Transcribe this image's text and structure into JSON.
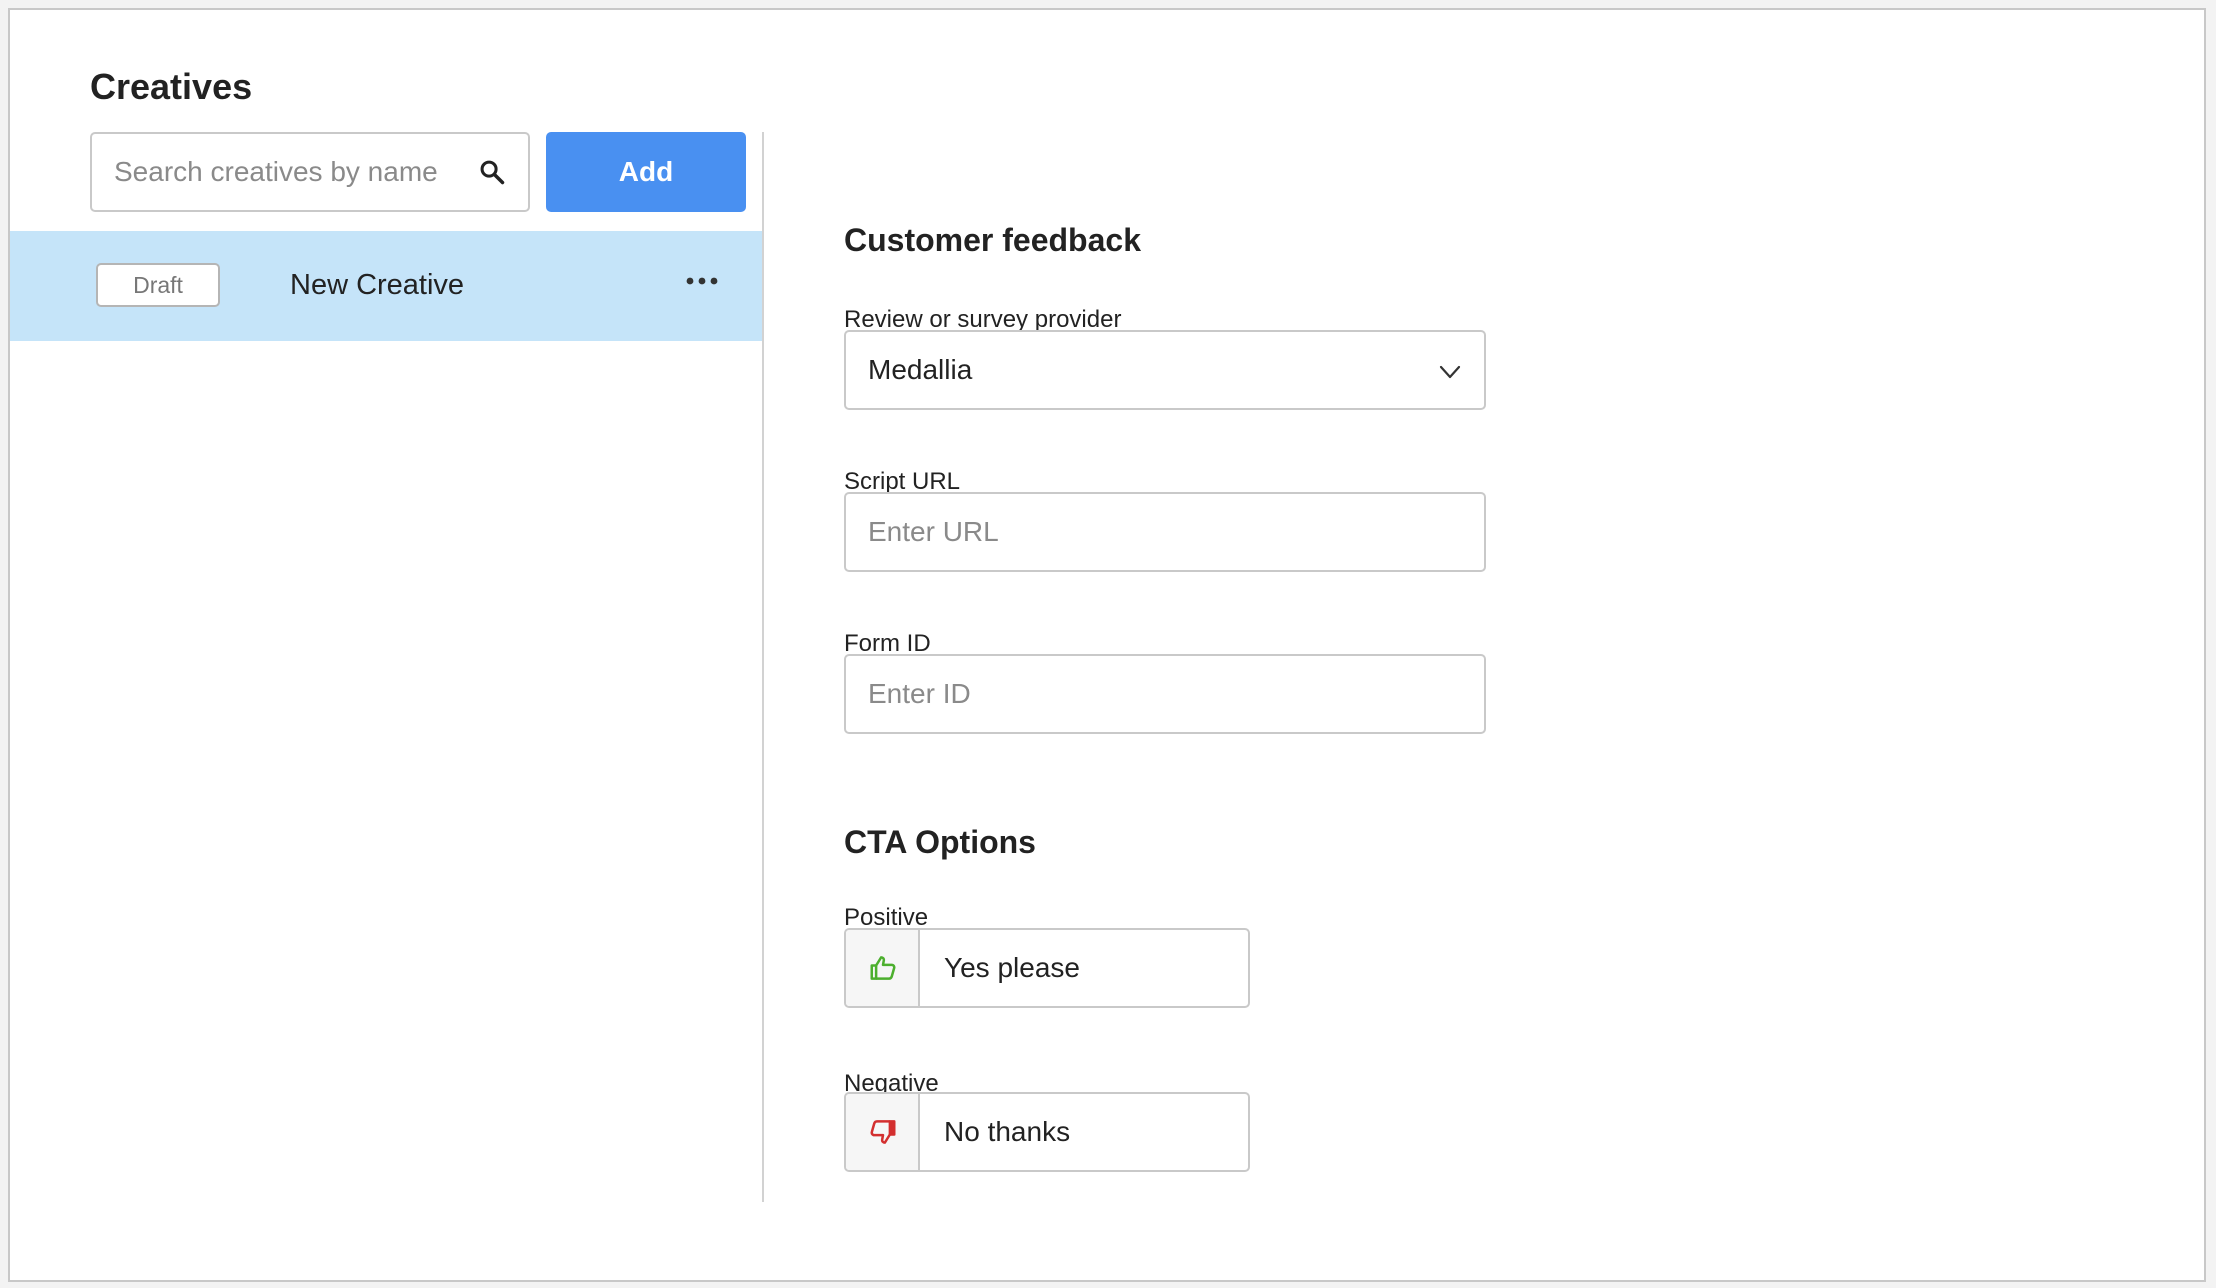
{
  "sidebar": {
    "title": "Creatives",
    "search_placeholder": "Search creatives by name",
    "add_label": "Add",
    "creatives": [
      {
        "status": "Draft",
        "name": "New Creative",
        "selected": true
      }
    ]
  },
  "customer_feedback": {
    "title": "Customer feedback",
    "provider_label": "Review or survey provider",
    "provider_value": "Medallia",
    "script_url_label": "Script URL",
    "script_url_placeholder": "Enter URL",
    "form_id_label": "Form ID",
    "form_id_placeholder": "Enter ID"
  },
  "cta_options": {
    "title": "CTA Options",
    "positive_label": "Positive",
    "positive_value": "Yes please",
    "negative_label": "Negative",
    "negative_value": "No thanks"
  },
  "colors": {
    "accent": "#4990f1",
    "selected_row": "#c5e4f9",
    "positive_icon": "#4caf2e",
    "negative_icon": "#d32f2f"
  },
  "icons": {
    "search": "search-icon",
    "more": "more-horizontal-icon",
    "chevron": "chevron-down-icon",
    "positive": "thumbs-up-icon",
    "negative": "thumbs-down-icon"
  }
}
